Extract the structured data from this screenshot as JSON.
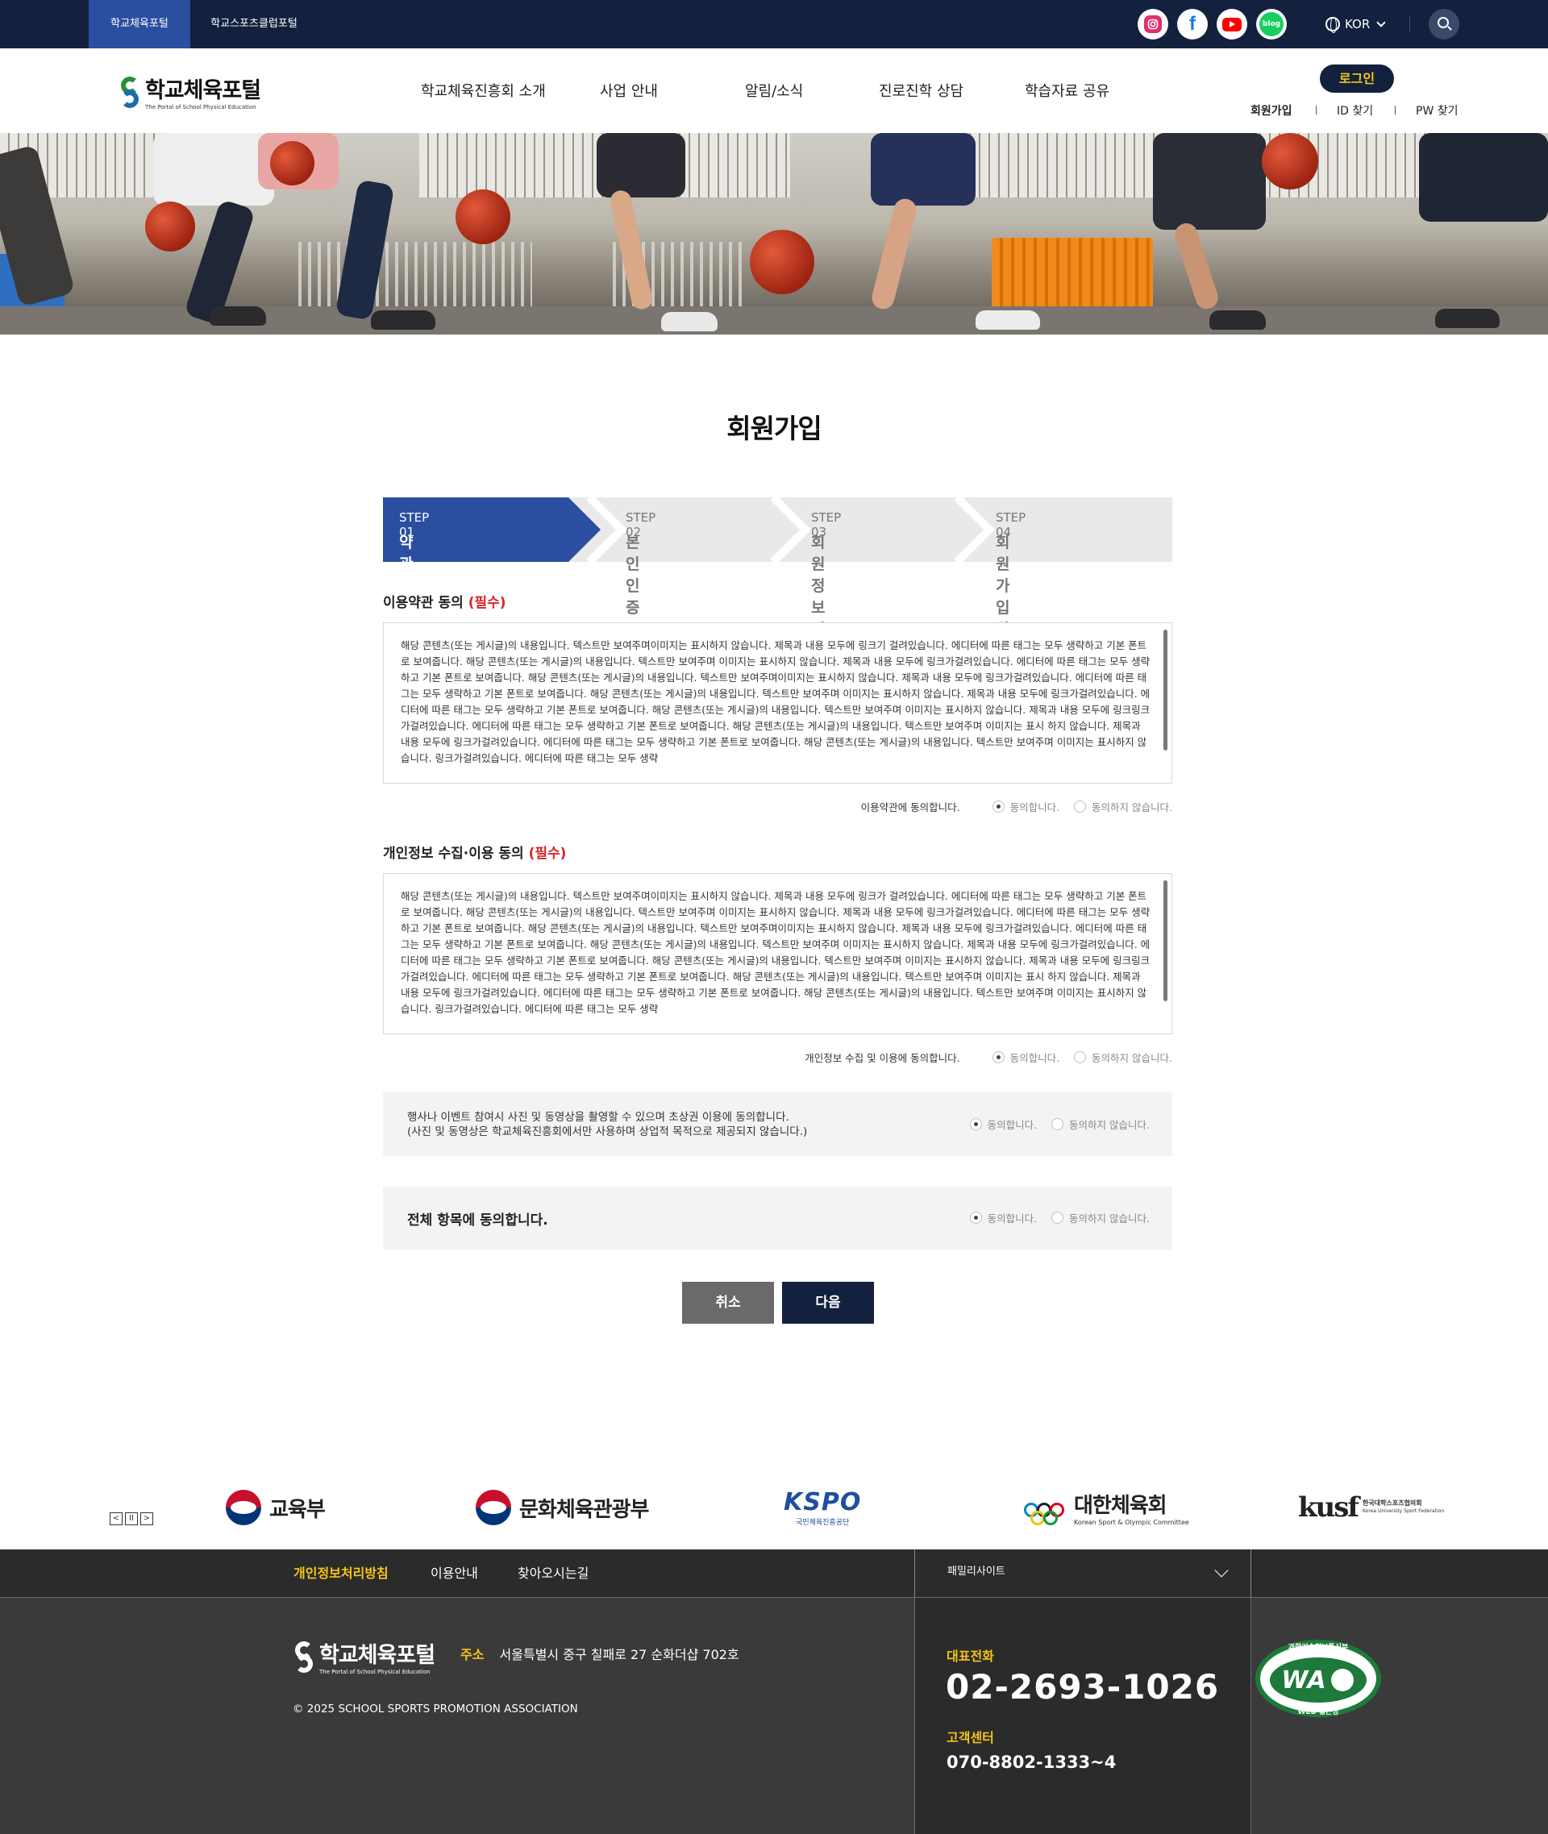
{
  "topbar": {
    "site_tabs": [
      "학교체육포털",
      "학교스포츠클럽포털"
    ],
    "sns": [
      "instagram-icon",
      "facebook-icon",
      "youtube-icon",
      "blog-icon"
    ],
    "blog_label": "blog",
    "facebook_glyph": "f",
    "language": "KOR"
  },
  "header": {
    "logo_title": "학교체육포털",
    "logo_subtitle": "The Portal of School Physical Education",
    "nav": [
      "학교체육진흥회 소개",
      "사업 안내",
      "알림/소식",
      "진로진학 상담",
      "학습자료 공유"
    ],
    "login": "로그인",
    "util_links": [
      "회원가입",
      "ID 찾기",
      "PW 찾기"
    ]
  },
  "main": {
    "page_title": "회원가입",
    "steps": [
      {
        "no": "STEP 01",
        "name": "약관 동의"
      },
      {
        "no": "STEP 02",
        "name": "본인 인증"
      },
      {
        "no": "STEP 03",
        "name": "회원정보 입력"
      },
      {
        "no": "STEP 04",
        "name": "회원가입 완료"
      }
    ],
    "active_step": 1,
    "terms": {
      "title": "이용약관 동의",
      "required": "(필수)",
      "body": "해당 콘텐츠(또는 게시글)의 내용입니다. 텍스트만 보여주며이미지는 표시하지 않습니다. 제목과 내용 모두에 링크기 걸려있습니다. 에디터에 따른 태그는 모두 생략하고 기본 폰트로 보여줍니다. 해당 콘텐츠(또는 게시글)의 내용입니다. 텍스트만 보여주며 이미지는 표시하지 않습니다. 제목과 내용 모두에 링크가걸려있습니다. 에디터에 따른 태그는 모두 생략하고 기본 폰트로 보여줍니다. 해당 콘텐츠(또는 게시글)의 내용입니다. 텍스트만 보여주며이미지는 표시하지 않습니다. 제목과 내용 모두에 링크가걸려있습니다. 에디터에 따른 태그는 모두 생략하고 기본 폰트로 보여줍니다. 해당 콘텐츠(또는 게시글)의 내용입니다. 텍스트만 보여주며 이미지는 표시하지 않습니다. 제목과 내용 모두에 링크가걸려있습니다. 에디터에 따른 태그는 모두 생략하고 기본 폰트로 보여줍니다. 해당 콘텐츠(또는 게시글)의 내용입니다. 텍스트만 보여주며 이미지는 표시하지 않습니다. 제목과 내용 모두에 링크링크가걸려있습니다. 에디터에 따른 태그는 모두 생략하고 기본 폰트로 보여줍니다. 해당 콘텐츠(또는 게시글)의 내용입니다. 텍스트만 보여주며 이미지는 표시 하지 않습니다. 제목과 내용 모두에 링크가걸려있습니다. 에디터에 따른 태그는 모두 생략하고 기본 폰트로 보여줍니다. 해당 콘텐츠(또는 게시글)의 내용입니다. 텍스트만 보여주며 이미지는 표시하지 않습니다. 링크가걸려있습니다. 에디터에 따른 태그는 모두 생략",
      "agree_question": "이용약관에 동의합니다.",
      "agree": "동의합니다.",
      "disagree": "동의하지 않습니다."
    },
    "privacy": {
      "title": "개인정보 수집·이용 동의",
      "required": "(필수)",
      "body": "해당 콘텐츠(또는 게시글)의 내용입니다. 텍스트만 보여주며이미지는 표시하지 않습니다. 제목과 내용 모두에 링크가 걸려있습니다. 에디터에 따른 태그는 모두 생략하고 기본 폰트로 보여줍니다. 해당 콘텐츠(또는 게시글)의 내용입니다. 텍스트만 보여주며 이미지는 표시하지 않습니다. 제목과 내용 모두에 링크가걸려있습니다. 에디터에 따른 태그는 모두 생략하고 기본 폰트로 보여줍니다. 해당 콘텐츠(또는 게시글)의 내용입니다. 텍스트만 보여주며이미지는 표시하지 않습니다. 제목과 내용 모두에 링크가걸려있습니다. 에디터에 따른 태그는 모두 생략하고 기본 폰트로 보여줍니다. 해당 콘텐츠(또는 게시글)의 내용입니다. 텍스트만 보여주며 이미지는 표시하지 않습니다. 제목과 내용 모두에 링크가걸려있습니다. 에디터에 따른 태그는 모두 생략하고 기본 폰트로 보여줍니다. 해당 콘텐츠(또는 게시글)의 내용입니다. 텍스트만 보여주며 이미지는 표시하지 않습니다. 제목과 내용 모두에 링크링크가걸려있습니다. 에디터에 따른 태그는 모두 생략하고 기본 폰트로 보여줍니다. 해당 콘텐츠(또는 게시글)의 내용입니다. 텍스트만 보여주며 이미지는 표시 하지 않습니다. 제목과 내용 모두에 링크가걸려있습니다. 에디터에 따른 태그는 모두 생략하고 기본 폰트로 보여줍니다. 해당 콘텐츠(또는 게시글)의 내용입니다. 텍스트만 보여주며 이미지는 표시하지 않습니다. 링크가걸려있습니다. 에디터에 따른 태그는 모두 생략",
      "agree_question": "개인정보 수집 및 이용에 동의합니다.",
      "agree": "동의합니다.",
      "disagree": "동의하지 않습니다."
    },
    "photo_consent": {
      "line1": "행사나 이벤트 참여시 사진 및 동영상을 촬영할 수 있으며 초상권 이용에 동의합니다.",
      "line2": "(사진 및 동영상은 학교체육진흥회에서만 사용하며 상업적 목적으로 제공되지 않습니다.)",
      "agree": "동의합니다.",
      "disagree": "동의하지 않습니다."
    },
    "all_consent": {
      "label": "전체 항목에 동의합니다.",
      "agree": "동의합니다.",
      "disagree": "동의하지 않습니다."
    },
    "buttons": {
      "cancel": "취소",
      "next": "다음"
    }
  },
  "partners": {
    "controls": [
      "<",
      "II",
      ">"
    ],
    "items": [
      "교육부",
      "문화체육관광부",
      "KSPO",
      "국민체육진흥공단",
      "대한체육회",
      "Korean Sport & Olympic Committee",
      "kusf",
      "한국대학스포츠협의회",
      "Korea University Sport Federation"
    ]
  },
  "footer": {
    "nav": [
      "개인정보처리방침",
      "이용안내",
      "찾아오시는길"
    ],
    "family_site": "패밀리사이트",
    "logo_title": "학교체육포털",
    "logo_subtitle": "The Portal of School Physical Education",
    "address_label": "주소",
    "address": "서울특별시 중구 칠패로 27 순화더샵 702호",
    "copyright": "© 2025 SCHOOL SPORTS PROMOTION ASSOCIATION",
    "tel_label": "대표전화",
    "tel": "02-2693-1026",
    "cs_label": "고객센터",
    "cs_tel": "070-8802-1333~4",
    "wa_badge_top": "과학기술정보통신부",
    "wa_badge_main": "WA",
    "wa_badge_bottom": "WEB 접근성"
  },
  "colors": {
    "navy": "#13213f",
    "step_active": "#2a4fa0",
    "required": "#d6262b",
    "accent_yellow": "#f5c518"
  }
}
